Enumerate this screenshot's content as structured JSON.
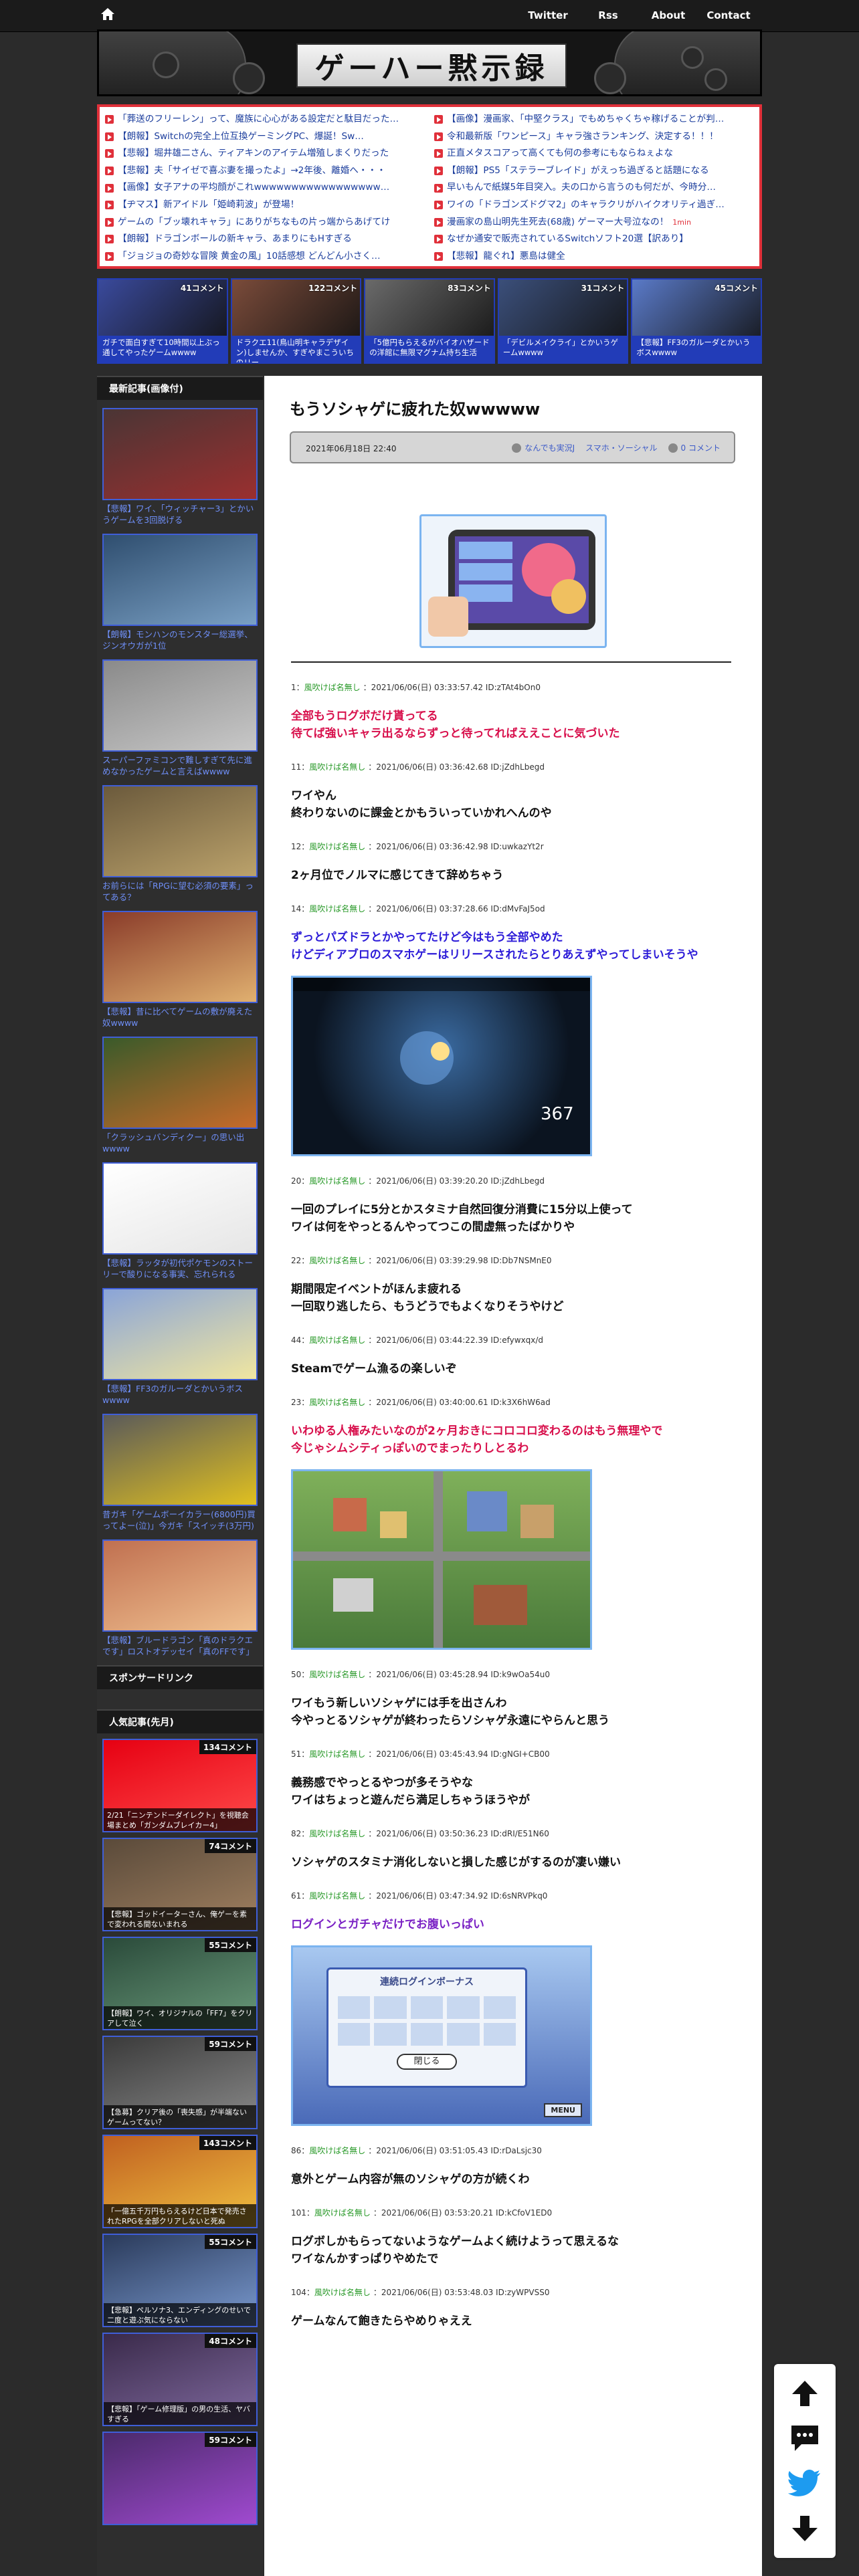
{
  "nav": {
    "home_icon": "home-icon",
    "links": [
      "Twitter",
      "Rss",
      "About",
      "Contact"
    ]
  },
  "site": {
    "title": "ゲーハー黙示録"
  },
  "rss_items": [
    {
      "text": "「葬送のフリーレン」って、魔族に心心がある設定だと駄目だった…"
    },
    {
      "text": "【画像】漫画家、「中堅クラス」でもめちゃくちゃ稼げることが判…"
    },
    {
      "text": "【朗報】Switchの完全上位互換ゲーミングPC、爆誕！Sw…"
    },
    {
      "text": "令和最新版「ワンピース」キャラ強さランキング、決定する！！！"
    },
    {
      "text": "【悲報】堀井雄二さん、ティアキンのアイテム増殖しまくりだった"
    },
    {
      "text": "正直メタスコアって高くても何の参考にもならねぇよな"
    },
    {
      "text": "【悲報】夫「サイゼで喜ぶ妻を撮ったよ」→2年後、離婚へ・・・"
    },
    {
      "text": "【朗報】PS5「ステラーブレイド」がえっち過ぎると話題になる"
    },
    {
      "text": "【画像】女子アナの平均顔がこれwwwwwwwwwwwwwwwww…"
    },
    {
      "text": "早いもんで紙媒5年目突入。夫の口から言うのも何だが、今時分…"
    },
    {
      "text": "【ヂマス】新アイドル「姫崎莉波」が登場！"
    },
    {
      "text": "ワイの「ドラゴンズドグマ2」のキャラクリがハイクオリティ過ぎ…"
    },
    {
      "text": "ゲームの「ブッ壊れキャラ」にありがちなもの片っ端からあげてけ"
    },
    {
      "text": "漫画家の島山明先生死去(68歳) ゲーマー大号泣なの！",
      "new": "1min"
    },
    {
      "text": "【朗報】ドラゴンボールの新キャラ、あまりにもHすぎる"
    },
    {
      "text": "なぜか通安で販売されているSwitchソフト20選【訳あり】"
    },
    {
      "text": "「ジョジョの奇妙な冒険 黄金の風」10話感想 どんどん小さく…"
    },
    {
      "text": "【悲報】龍ぐれ】悪島は健全"
    }
  ],
  "featured": [
    {
      "count": "41コメント",
      "caption": "ガチで面白すぎて10時間以上ぶっ通してやったゲームwwww",
      "color": "#3a4a9c"
    },
    {
      "count": "122コメント",
      "caption": "ドラクエ11(鳥山明キャラデザイン)しませんか、すぎやまこういちのリー",
      "color": "#7a4b3a"
    },
    {
      "count": "83コメント",
      "caption": "「5億円もらえるがバイオハザードの洋館に無限マグナム持ち生活",
      "color": "#6a6a6a"
    },
    {
      "count": "31コメント",
      "caption": "「デビルメイクライ」とかいうゲームwwww",
      "color": "#3b4f7a"
    },
    {
      "count": "45コメント",
      "caption": "【悲報】FF3のガルーダとかいうボスwwww",
      "color": "#5a7ac8"
    }
  ],
  "sidebar": {
    "recent_head": "最新記事(画像付)",
    "recent": [
      {
        "title": "【悲報】ワイ、「ウィッチャー3」とかいうゲームを3回脱げる",
        "c1": "#4a3535",
        "c2": "#9a2f2f"
      },
      {
        "title": "【朗報】モンハンのモンスター総選挙、ジンオウガが1位",
        "c1": "#2f4e6f",
        "c2": "#7aa0c4"
      },
      {
        "title": "スーパーファミコンで難しすぎて先に進めなかったゲームと言えばwwww",
        "c1": "#8a8a8a",
        "c2": "#c8c8c8"
      },
      {
        "title": "お前らには「RPGに望む必須の要素」ってある？",
        "c1": "#6b5a3c",
        "c2": "#bba26b"
      },
      {
        "title": "【悲報】昔に比べてゲームの敷が廃えた奴wwww",
        "c1": "#8a3c2a",
        "c2": "#e0b070"
      },
      {
        "title": "「クラッシュバンディクー」の思い出wwww",
        "c1": "#3a5a2a",
        "c2": "#c66a2a"
      },
      {
        "title": "【悲報】ラッタが初代ポケモンのストーリーで酸りになる事実、忘れられる",
        "c1": "#ffffff",
        "c2": "#e6e6e6"
      },
      {
        "title": "【悲報】FF3のガルーダとかいうボスwwww",
        "c1": "#8aa4d8",
        "c2": "#f0e6a0"
      },
      {
        "title": "昔ガキ「ゲームボーイカラー(6800円)買ってよー(泣)」今ガキ「スイッチ(3万円)買ってよー(泣)」",
        "c1": "#5a5a5a",
        "c2": "#e0c020"
      },
      {
        "title": "【悲報】ブルードラゴン「真のドラクエです」ロストオデッセイ「真のFFです」→失敗した理由",
        "c1": "#c07050",
        "c2": "#f0c090"
      }
    ],
    "sponsor_head": "スポンサードリンク",
    "popular_head": "人気記事(先月)",
    "popular": [
      {
        "count": "134コメント",
        "caption": "2/21「ニンテンドーダイレクト」を視聴会場まとめ「ガンダムブレイカー4」",
        "c1": "#e60012",
        "c2": "#ff4a4a"
      },
      {
        "count": "74コメント",
        "caption": "【悲報】ゴッドイーターさん、俺ゲーを素で変われる間ないまれる",
        "c1": "#5a4a3a",
        "c2": "#a08060"
      },
      {
        "count": "55コメント",
        "caption": "【朗報】ワイ、オリジナルの「FF7」をクリアして泣く",
        "c1": "#2a4a3a",
        "c2": "#6a9a7a"
      },
      {
        "count": "59コメント",
        "caption": "【急募】クリア後の「喪失感」が半端ないゲームってない？",
        "c1": "#3a3a3a",
        "c2": "#8a8a8a"
      },
      {
        "count": "143コメント",
        "caption": "「一億五千万円もらえるけど日本で発売されたRPGを全部クリアしないと死ぬ",
        "c1": "#c06020",
        "c2": "#f0c040"
      },
      {
        "count": "55コメント",
        "caption": "【悲報】ペルソナ3、エンディングのせいで二度と遊ぶ気にならない",
        "c1": "#2a3a5a",
        "c2": "#7a9ad0"
      },
      {
        "count": "48コメント",
        "caption": "【悲報】「ゲーム修理版」の男の生活、ヤバすぎる",
        "c1": "#3a2a4a",
        "c2": "#806aa0"
      },
      {
        "count": "59コメント",
        "caption": "",
        "c1": "#4a2a6a",
        "c2": "#a04ad0"
      }
    ]
  },
  "article": {
    "title": "もうソシャゲに疲れた奴wwwww",
    "date": "2021年06月18日 22:40",
    "cats": [
      "なんでも実況J",
      "スマホ・ソーシャル",
      "0 コメント"
    ],
    "posts": [
      {
        "no": "1：",
        "name": "風吹けば名無し",
        "info": "：2021/06/06(日) 03:33:57.42 ID:zTAt4bOn0",
        "lines": [
          "全部もうログボだけ貰ってる",
          "待てば強いキャラ出るならずっと待ってればええことに気づいた"
        ],
        "style": "red"
      },
      {
        "no": "11：",
        "name": "風吹けば名無し",
        "info": "：2021/06/06(日) 03:36:42.68 ID:jZdhLbegd",
        "lines": [
          "ワイやん",
          "終わりないのに課金とかもういっていかれへんのや"
        ],
        "style": ""
      },
      {
        "no": "12：",
        "name": "風吹けば名無し",
        "info": "：2021/06/06(日) 03:36:42.98 ID:uwkazYt2r",
        "lines": [
          "2ヶ月位でノルマに感じてきて辞めちゃう"
        ],
        "style": ""
      },
      {
        "no": "14：",
        "name": "風吹けば名無し",
        "info": "：2021/06/06(日) 03:37:28.66 ID:dMvFaJ5od",
        "lines": [
          "ずっとパズドラとかやってたけど今はもう全部やめた",
          "けどディアブロのスマホゲーはリリースされたらとりあえずやってしまいそうや"
        ],
        "style": "blue",
        "image": "dark"
      },
      {
        "no": "20：",
        "name": "風吹けば名無し",
        "info": "：2021/06/06(日) 03:39:20.20 ID:jZdhLbegd",
        "lines": [
          "一回のプレイに5分とかスタミナ自然回復分消費に15分以上使って",
          "ワイは何をやっとるんやってつこの間虚無ったばかりや"
        ],
        "style": ""
      },
      {
        "no": "22：",
        "name": "風吹けば名無し",
        "info": "：2021/06/06(日) 03:39:29.98 ID:Db7NSMnE0",
        "lines": [
          "期間限定イベントがほんま疲れる",
          "一回取り逃したら、もうどうでもよくなりそうやけど"
        ],
        "style": ""
      },
      {
        "no": "44：",
        "name": "風吹けば名無し",
        "info": "：2021/06/06(日) 03:44:22.39 ID:efywxqx/d",
        "lines": [
          "Steamでゲーム漁るの楽しいぞ"
        ],
        "style": ""
      },
      {
        "no": "23：",
        "name": "風吹けば名無し",
        "info": "：2021/06/06(日) 03:40:00.61 ID:k3X6hW6ad",
        "lines": [
          "いわゆる人権みたいなのが2ヶ月おきにコロコロ変わるのはもう無理やで",
          "今じゃシムシティっぽいのでまったりしとるわ"
        ],
        "style": "red",
        "image": "city"
      },
      {
        "no": "50：",
        "name": "風吹けば名無し",
        "info": "：2021/06/06(日) 03:45:28.94 ID:k9wOa54u0",
        "lines": [
          "ワイもう新しいソシャゲには手を出さんわ",
          "今やっとるソシャゲが終わったらソシャゲ永遠にやらんと思う"
        ],
        "style": ""
      },
      {
        "no": "51：",
        "name": "風吹けば名無し",
        "info": "：2021/06/06(日) 03:45:43.94 ID:gNGI+CB00",
        "lines": [
          "義務感でやっとるやつが多そうやな",
          "ワイはちょっと遊んだら満足しちゃうほうやが"
        ],
        "style": ""
      },
      {
        "no": "82：",
        "name": "風吹けば名無し",
        "info": "：2021/06/06(日) 03:50:36.23 ID:dRI/E51N60",
        "lines": [
          "ソシャゲのスタミナ消化しないと損した感じがするのが凄い嫌い"
        ],
        "style": ""
      },
      {
        "no": "61：",
        "name": "風吹けば名無し",
        "info": "：2021/06/06(日) 03:47:34.92 ID:6sNRVPkq0",
        "lines": [
          "ログインとガチャだけでお腹いっぱい"
        ],
        "style": "purple",
        "image": "login"
      },
      {
        "no": "86：",
        "name": "風吹けば名無し",
        "info": "：2021/06/06(日) 03:51:05.43 ID:rDaLsjc30",
        "lines": [
          "意外とゲーム内容が無のソシャゲの方が続くわ"
        ],
        "style": ""
      },
      {
        "no": "101：",
        "name": "風吹けば名無し",
        "info": "：2021/06/06(日) 03:53:20.21 ID:kCfoV1ED0",
        "lines": [
          "ログボしかもらってないようなゲームよく続けようって思えるな",
          "ワイなんかすっぱりやめたで"
        ],
        "style": ""
      },
      {
        "no": "104：",
        "name": "風吹けば名無し",
        "info": "：2021/06/06(日) 03:53:48.03 ID:zyWPVSS0",
        "lines": [
          "ゲームなんて飽きたらやめりゃええ"
        ],
        "style": ""
      }
    ],
    "login_window": "連続ログインボーナス",
    "login_close": "閉じる",
    "login_menu": "MENU",
    "dmg": "367"
  },
  "float": [
    "arrow-up-icon",
    "comment-icon",
    "twitter-icon",
    "arrow-down-icon"
  ]
}
